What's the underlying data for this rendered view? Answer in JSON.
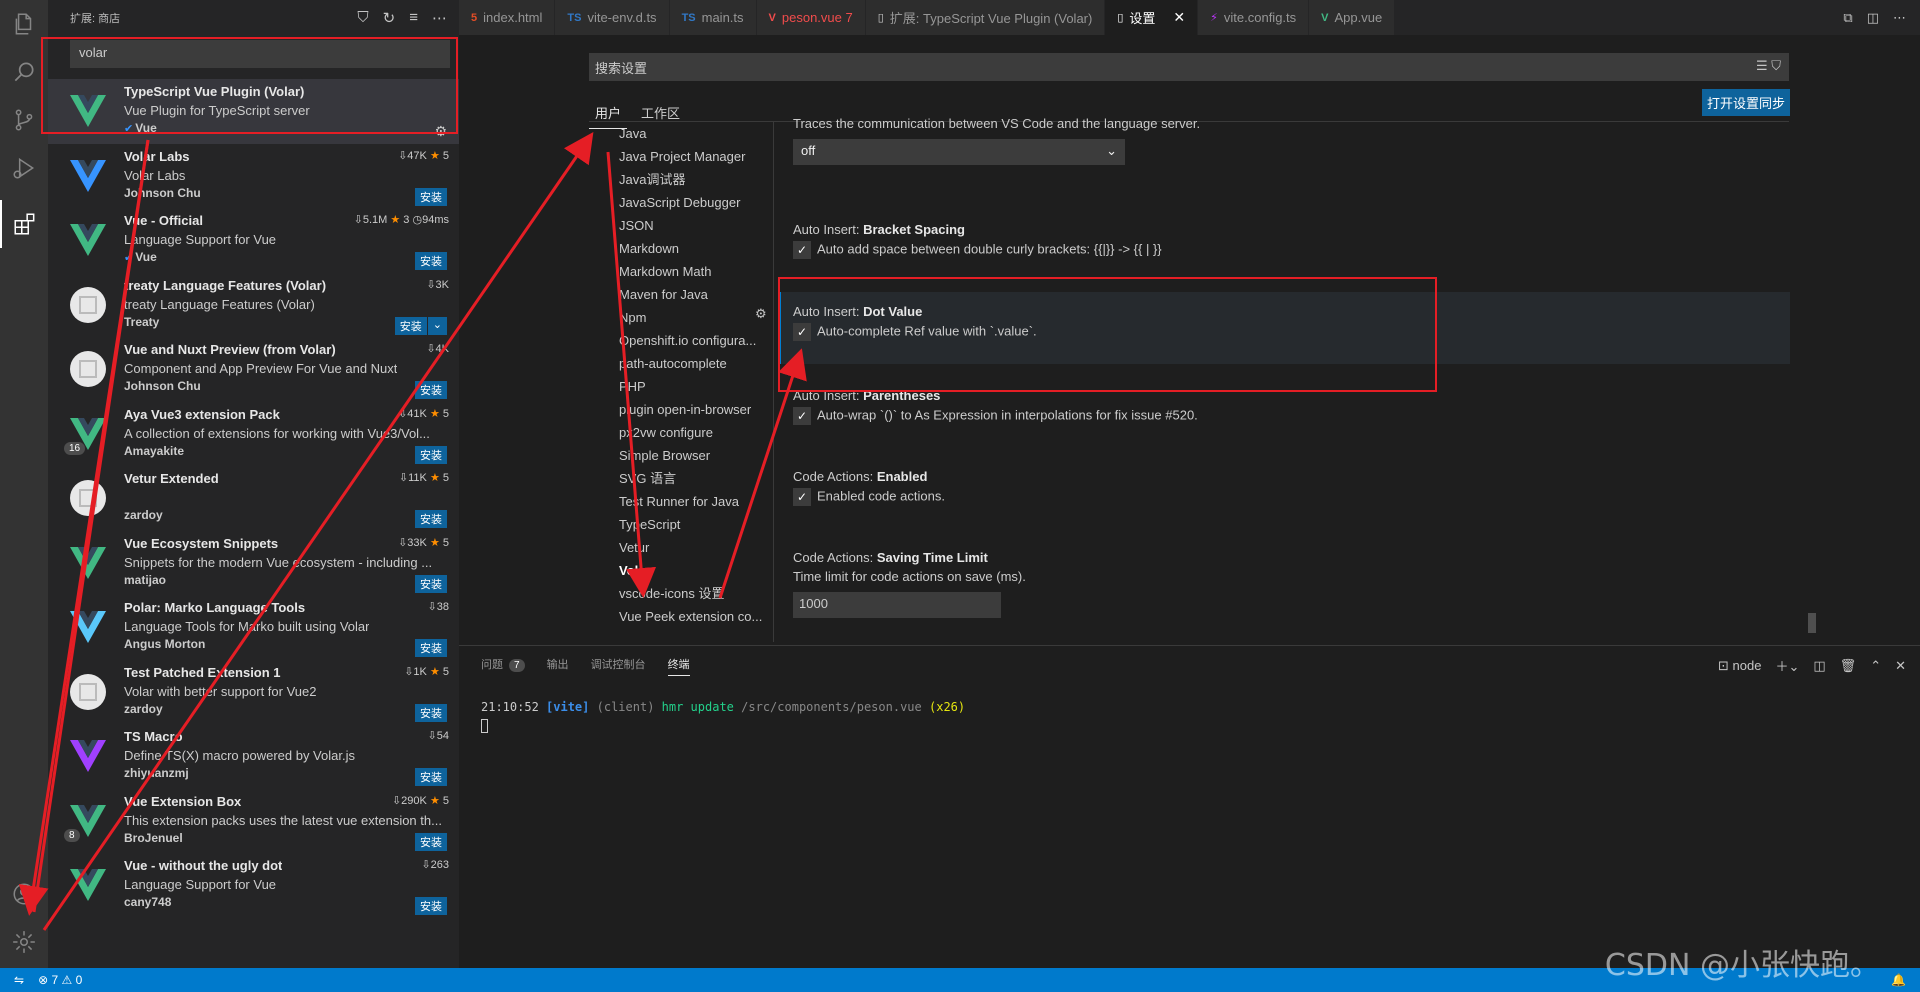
{
  "sidebar": {
    "title": "扩展: 商店",
    "search_value": "volar",
    "extensions": [
      {
        "name": "TypeScript Vue Plugin (Volar)",
        "desc": "Vue Plugin for TypeScript server",
        "publisher": "Vue",
        "stats": "",
        "rating": "",
        "installed": true
      },
      {
        "name": "Volar Labs",
        "desc": "Volar Labs",
        "publisher": "Johnson Chu",
        "stats": "47K",
        "rating": "5",
        "action": "安装"
      },
      {
        "name": "Vue - Official",
        "desc": "Language Support for Vue",
        "publisher": "Vue",
        "stats": "5.1M",
        "rating": "3",
        "time": "94ms",
        "action": "安装"
      },
      {
        "name": "treaty Language Features (Volar)",
        "desc": "treaty Language Features (Volar)",
        "publisher": "Treaty",
        "stats": "3K",
        "rating": "",
        "action": "安装"
      },
      {
        "name": "Vue and Nuxt Preview (from Volar)",
        "desc": "Component and App Preview For Vue and Nuxt",
        "publisher": "Johnson Chu",
        "stats": "4K",
        "rating": "",
        "action": "安装"
      },
      {
        "name": "Aya Vue3 extension Pack",
        "desc": "A collection of extensions for working with Vue3/Vol...",
        "publisher": "Amayakite",
        "stats": "41K",
        "rating": "5",
        "action": "安装",
        "badge": "16"
      },
      {
        "name": "Vetur Extended",
        "desc": "",
        "publisher": "zardoy",
        "stats": "11K",
        "rating": "5",
        "action": "安装"
      },
      {
        "name": "Vue Ecosystem Snippets",
        "desc": "Snippets for the modern Vue ecosystem - including ...",
        "publisher": "matijao",
        "stats": "33K",
        "rating": "5",
        "action": "安装"
      },
      {
        "name": "Polar: Marko Language Tools",
        "desc": "Language Tools for Marko built using Volar",
        "publisher": "Angus Morton",
        "stats": "38",
        "rating": "",
        "action": "安装"
      },
      {
        "name": "Test Patched Extension 1",
        "desc": "Volar with better support for Vue2",
        "publisher": "zardoy",
        "stats": "1K",
        "rating": "5",
        "action": "安装"
      },
      {
        "name": "TS Macro",
        "desc": "Define TS(X) macro powered by Volar.js",
        "publisher": "zhiyuanzmj",
        "stats": "54",
        "rating": "",
        "action": "安装"
      },
      {
        "name": "Vue Extension Box",
        "desc": "This extension packs uses the latest vue extension th...",
        "publisher": "BroJenuel",
        "stats": "290K",
        "rating": "5",
        "action": "安装",
        "badge": "8"
      },
      {
        "name": "Vue - without the ugly dot",
        "desc": "Language Support for Vue",
        "publisher": "cany748",
        "stats": "263",
        "rating": "",
        "action": "安装"
      }
    ]
  },
  "tabs": [
    {
      "label": "index.html",
      "icon": "html-icon",
      "color": "#e44d26"
    },
    {
      "label": "vite-env.d.ts",
      "icon": "ts-icon",
      "color": "#3178c6"
    },
    {
      "label": "main.ts",
      "icon": "ts-icon",
      "color": "#3178c6"
    },
    {
      "label": "peson.vue 7",
      "icon": "vue-icon",
      "color": "#f14c4c"
    },
    {
      "label": "扩展: TypeScript Vue Plugin (Volar)",
      "icon": "file-icon",
      "color": "#cccccc"
    },
    {
      "label": "设置",
      "icon": "file-icon",
      "color": "#ffffff",
      "active": true
    },
    {
      "label": "vite.config.ts",
      "icon": "vite-icon",
      "color": "#bd34fe"
    },
    {
      "label": "App.vue",
      "icon": "vue-icon",
      "color": "#41b883"
    }
  ],
  "settings": {
    "search_placeholder": "搜索设置",
    "scope_user": "用户",
    "scope_workspace": "工作区",
    "sync_button": "打开设置同步",
    "toc": [
      "Java",
      "Java Project Manager",
      "Java调试器",
      "JavaScript Debugger",
      "JSON",
      "Markdown",
      "Markdown Math",
      "Maven for Java",
      "Npm",
      "Openshift.io configura...",
      "path-autocomplete",
      "PHP",
      "plugin open-in-browser",
      "px2vw configure",
      "Simple Browser",
      "SVG 语言",
      "Test Runner for Java",
      "TypeScript",
      "Vetur",
      "Volar",
      "vscode-icons 设置",
      "Vue Peek extension co..."
    ],
    "toc_active": "Volar",
    "trace_desc": "Traces the communication between VS Code and the language server.",
    "trace_value": "off",
    "items": [
      {
        "prefix": "Auto Insert: ",
        "key": "Bracket Spacing",
        "desc": "Auto add space between double curly brackets: {{|}} -> {{ | }}"
      },
      {
        "prefix": "Auto Insert: ",
        "key": "Dot Value",
        "desc": "Auto-complete Ref value with `.value`."
      },
      {
        "prefix": "Auto Insert: ",
        "key": "Parentheses",
        "desc": "Auto-wrap `()` to As Expression in interpolations for fix issue #520."
      },
      {
        "prefix": "Code Actions: ",
        "key": "Enabled",
        "desc": "Enabled code actions."
      },
      {
        "prefix": "Code Actions: ",
        "key": "Saving Time Limit",
        "desc": "Time limit for code actions on save (ms).",
        "value": "1000"
      }
    ]
  },
  "panel": {
    "tabs": [
      "问题",
      "输出",
      "调试控制台",
      "终端"
    ],
    "problems_count": "7",
    "terminal_name": "node",
    "line": {
      "time": "21:10:52",
      "tag": "[vite]",
      "client": "(client)",
      "msg": "hmr update",
      "path": "/src/components/peson.vue",
      "count": "(x26)"
    }
  },
  "status": {
    "errors": "7",
    "warnings": "0"
  },
  "watermark": "CSDN @小张快跑。",
  "colors": {
    "accent": "#007acc",
    "annotation": "#e51e25",
    "install": "#0e639c"
  }
}
